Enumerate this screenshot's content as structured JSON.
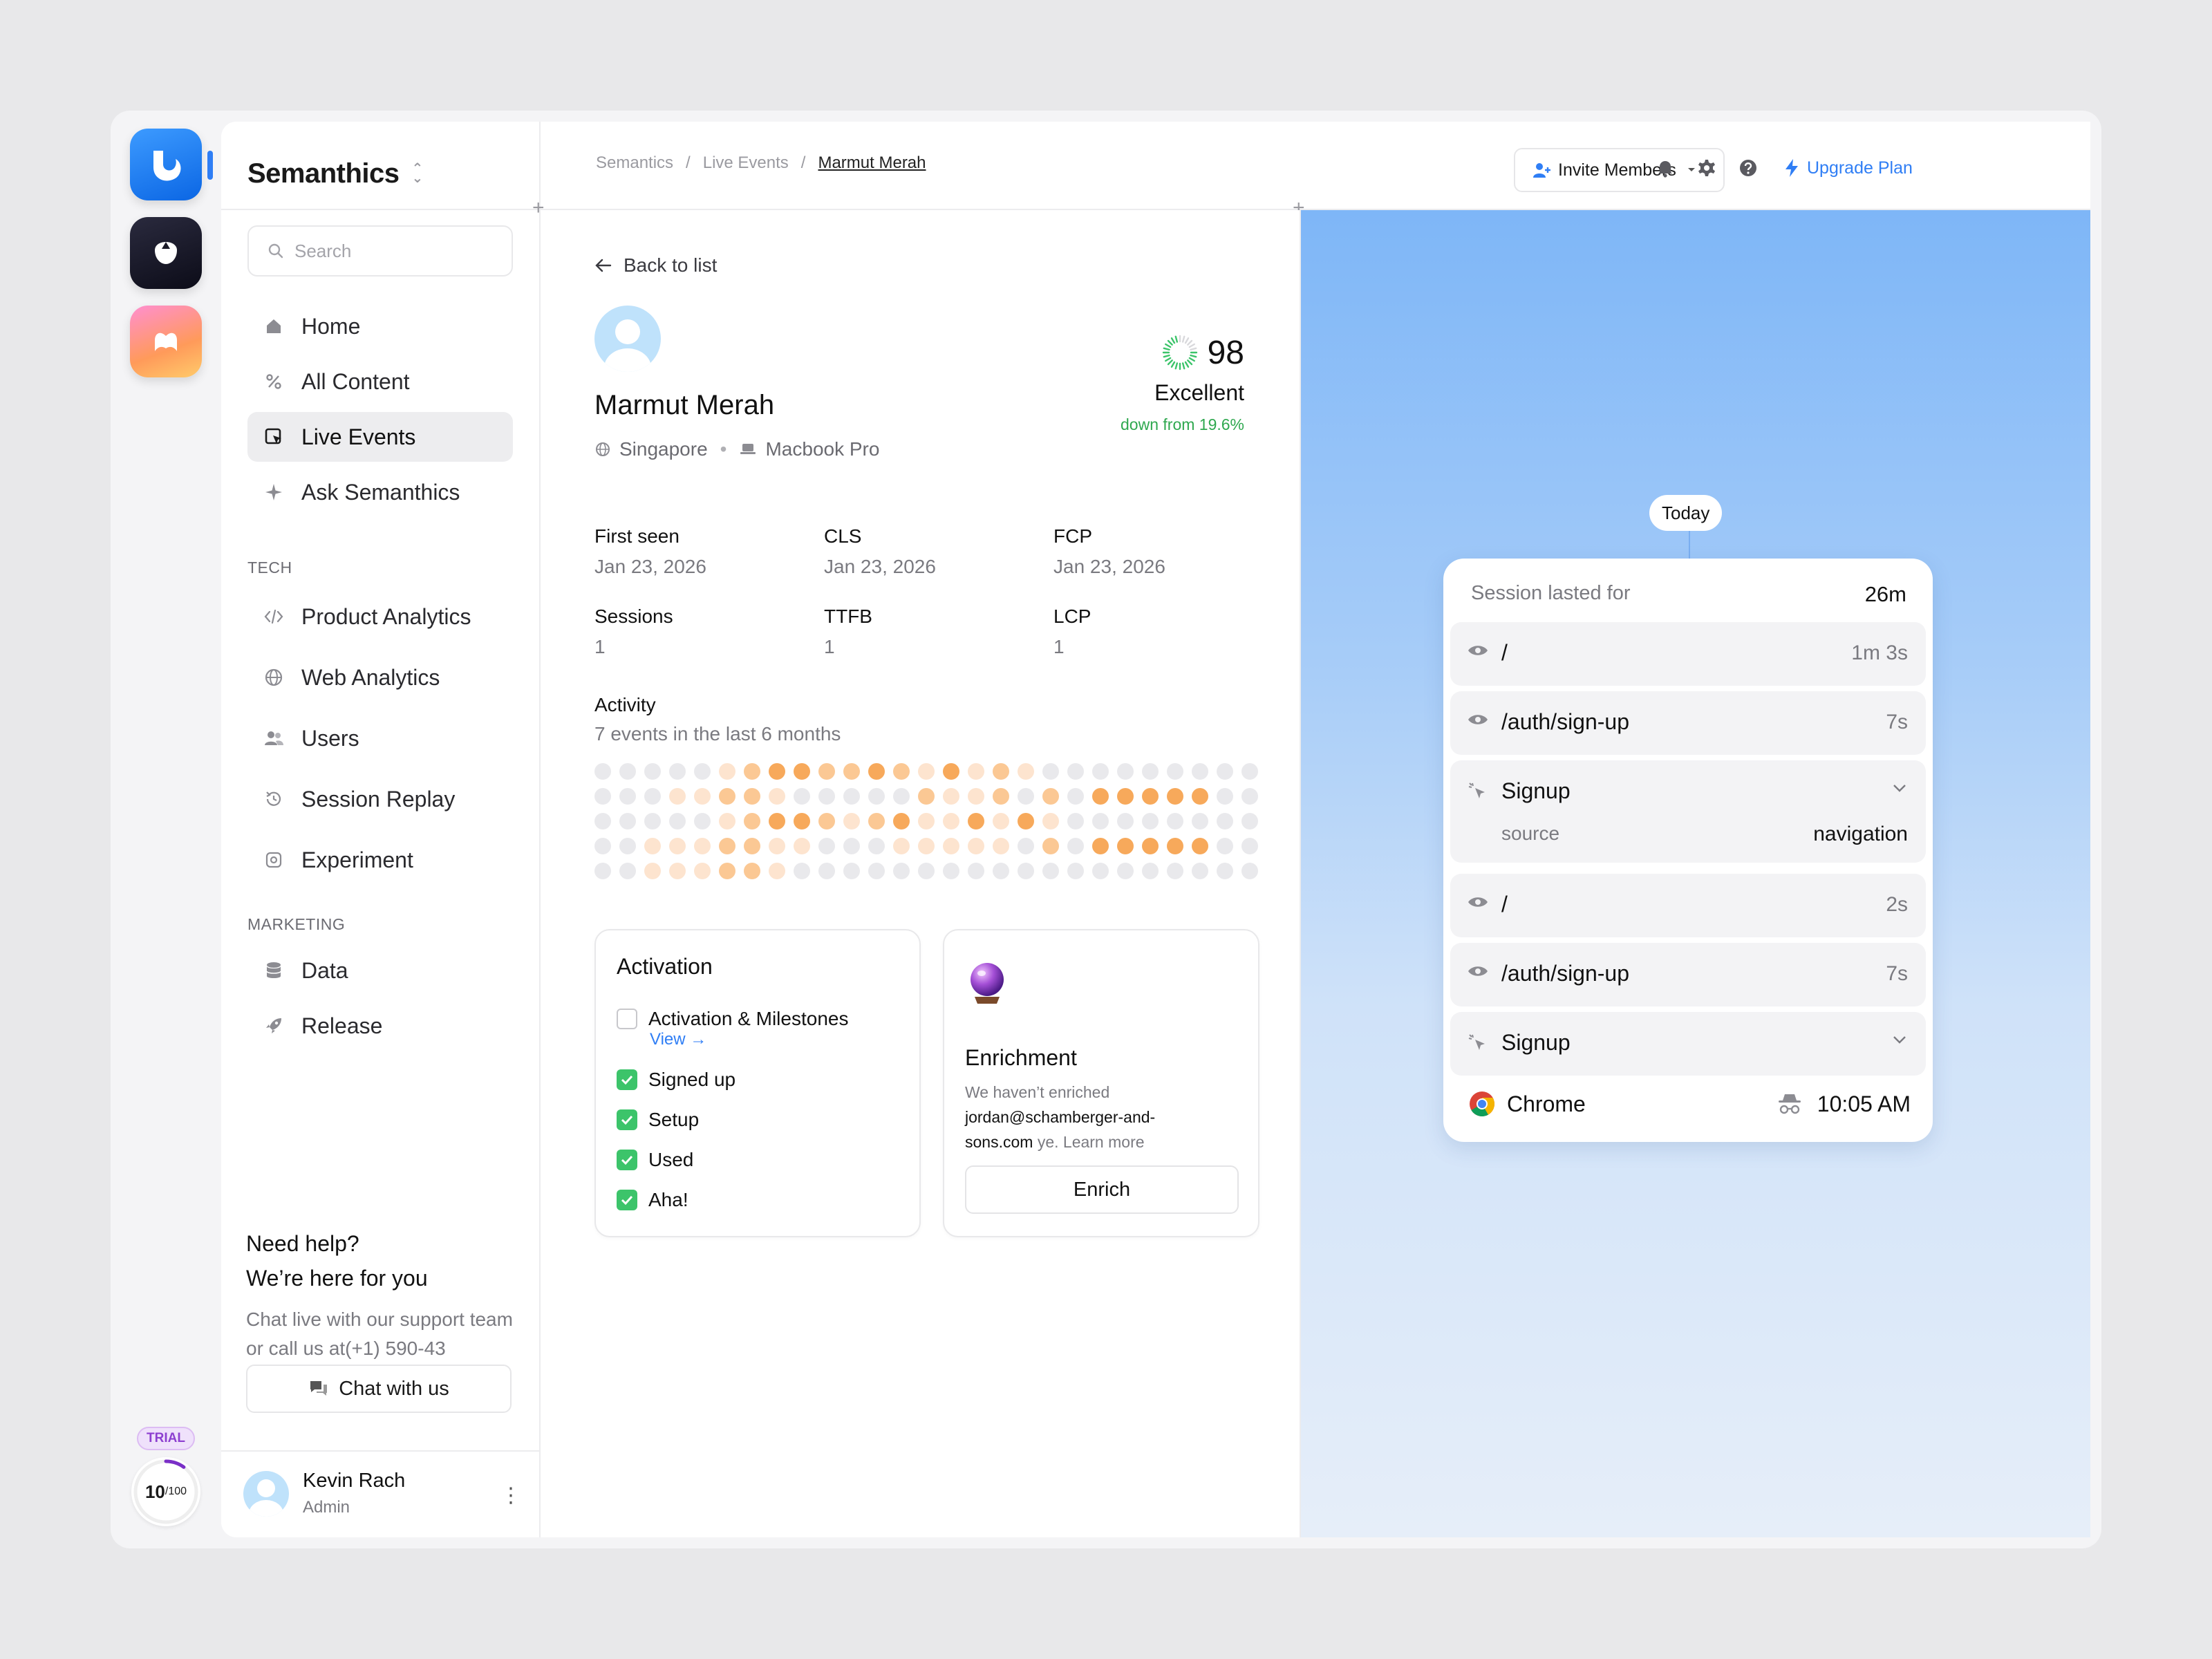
{
  "app": {
    "name": "Semanthics",
    "trial_badge": "TRIAL",
    "quota": {
      "used": "10",
      "total": "/100",
      "fraction": 0.1
    }
  },
  "sidebar": {
    "search_placeholder": "Search",
    "items": [
      {
        "label": "Home",
        "icon": "home-icon"
      },
      {
        "label": "All Content",
        "icon": "percent-icon"
      },
      {
        "label": "Live Events",
        "icon": "cursor-window-icon",
        "active": true
      },
      {
        "label": "Ask Semanthics",
        "icon": "sparkle-icon"
      }
    ],
    "tech_label": "TECH",
    "tech_items": [
      {
        "label": "Product Analytics",
        "icon": "code-icon"
      },
      {
        "label": "Web Analytics",
        "icon": "globe-icon"
      },
      {
        "label": "Users",
        "icon": "users-icon"
      },
      {
        "label": "Session Replay",
        "icon": "replay-icon"
      },
      {
        "label": "Experiment",
        "icon": "flask-icon"
      }
    ],
    "marketing_label": "MARKETING",
    "marketing_items": [
      {
        "label": "Data",
        "icon": "database-icon"
      },
      {
        "label": "Release",
        "icon": "rocket-icon"
      }
    ],
    "help": {
      "title_1": "Need help?",
      "title_2": "We’re here for you",
      "text": "Chat live with our support team or call us at(+1) 590-43",
      "button": "Chat with us"
    },
    "user": {
      "name": "Kevin Rach",
      "role": "Admin"
    }
  },
  "header": {
    "breadcrumb": [
      "Semantics",
      "/",
      "Live Events",
      "/",
      "Marmut Merah"
    ],
    "invite": "Invite Members",
    "upgrade": "Upgrade Plan"
  },
  "profile": {
    "back": "Back to list",
    "name": "Marmut Merah",
    "location": "Singapore",
    "device": "Macbook Pro",
    "score": "98",
    "score_label": "Excellent",
    "score_delta": "down from 19.6%",
    "stats": [
      {
        "k": "First seen",
        "v": "Jan 23, 2026"
      },
      {
        "k": "CLS",
        "v": "Jan 23, 2026"
      },
      {
        "k": "FCP",
        "v": "Jan 23, 2026"
      },
      {
        "k": "Sessions",
        "v": "1"
      },
      {
        "k": "TTFB",
        "v": "1"
      },
      {
        "k": "LCP",
        "v": "1"
      }
    ],
    "activity_title": "Activity",
    "activity_sub": "7 events in the last 6 months",
    "activity_grid": [
      [
        0,
        0,
        0,
        0,
        0,
        1,
        2,
        3,
        3,
        2,
        2,
        3,
        2,
        1,
        3,
        1,
        2,
        1,
        0,
        0,
        0,
        0,
        0,
        0,
        0,
        0,
        0
      ],
      [
        0,
        0,
        0,
        1,
        1,
        2,
        2,
        1,
        0,
        0,
        0,
        0,
        0,
        2,
        1,
        1,
        2,
        0,
        2,
        0,
        3,
        3,
        3,
        3,
        3,
        0,
        0
      ],
      [
        0,
        0,
        0,
        0,
        0,
        1,
        2,
        3,
        3,
        2,
        1,
        2,
        3,
        1,
        1,
        3,
        1,
        3,
        1,
        0,
        0,
        0,
        0,
        0,
        0,
        0,
        0
      ],
      [
        0,
        0,
        1,
        1,
        1,
        2,
        2,
        1,
        1,
        0,
        0,
        0,
        1,
        1,
        1,
        1,
        1,
        0,
        2,
        0,
        3,
        3,
        3,
        3,
        3,
        0,
        0
      ],
      [
        0,
        0,
        1,
        1,
        1,
        2,
        2,
        1,
        0,
        0,
        0,
        0,
        0,
        0,
        0,
        0,
        0,
        0,
        0,
        0,
        0,
        0,
        0,
        0,
        0,
        0,
        0
      ]
    ],
    "activation": {
      "title": "Activation",
      "milestones": "Activation & Milestones",
      "view": "View →",
      "items": [
        "Signed up",
        "Setup",
        "Used",
        "Aha!"
      ]
    },
    "enrichment": {
      "title": "Enrichment",
      "text_1": "We haven’t enriched",
      "email": "jordan@schamberger-and-sons.com",
      "text_2": " ye. Learn more",
      "button": "Enrich"
    }
  },
  "session": {
    "today": "Today",
    "lasted_label": "Session lasted for",
    "lasted_value": "26m",
    "rows": [
      {
        "type": "page",
        "path": "/",
        "dur": "1m 3s"
      },
      {
        "type": "page",
        "path": "/auth/sign-up",
        "dur": "7s"
      },
      {
        "type": "event",
        "name": "Signup",
        "key": "source",
        "value": "navigation"
      },
      {
        "type": "page",
        "path": "/",
        "dur": "2s"
      },
      {
        "type": "page",
        "path": "/auth/sign-up",
        "dur": "7s"
      },
      {
        "type": "event",
        "name": "Signup"
      }
    ],
    "browser": "Chrome",
    "time": "10:05 AM"
  },
  "colors": {
    "accent": "#2f7ef5",
    "success": "#3cc46a",
    "trial": "#8d3fd0"
  }
}
